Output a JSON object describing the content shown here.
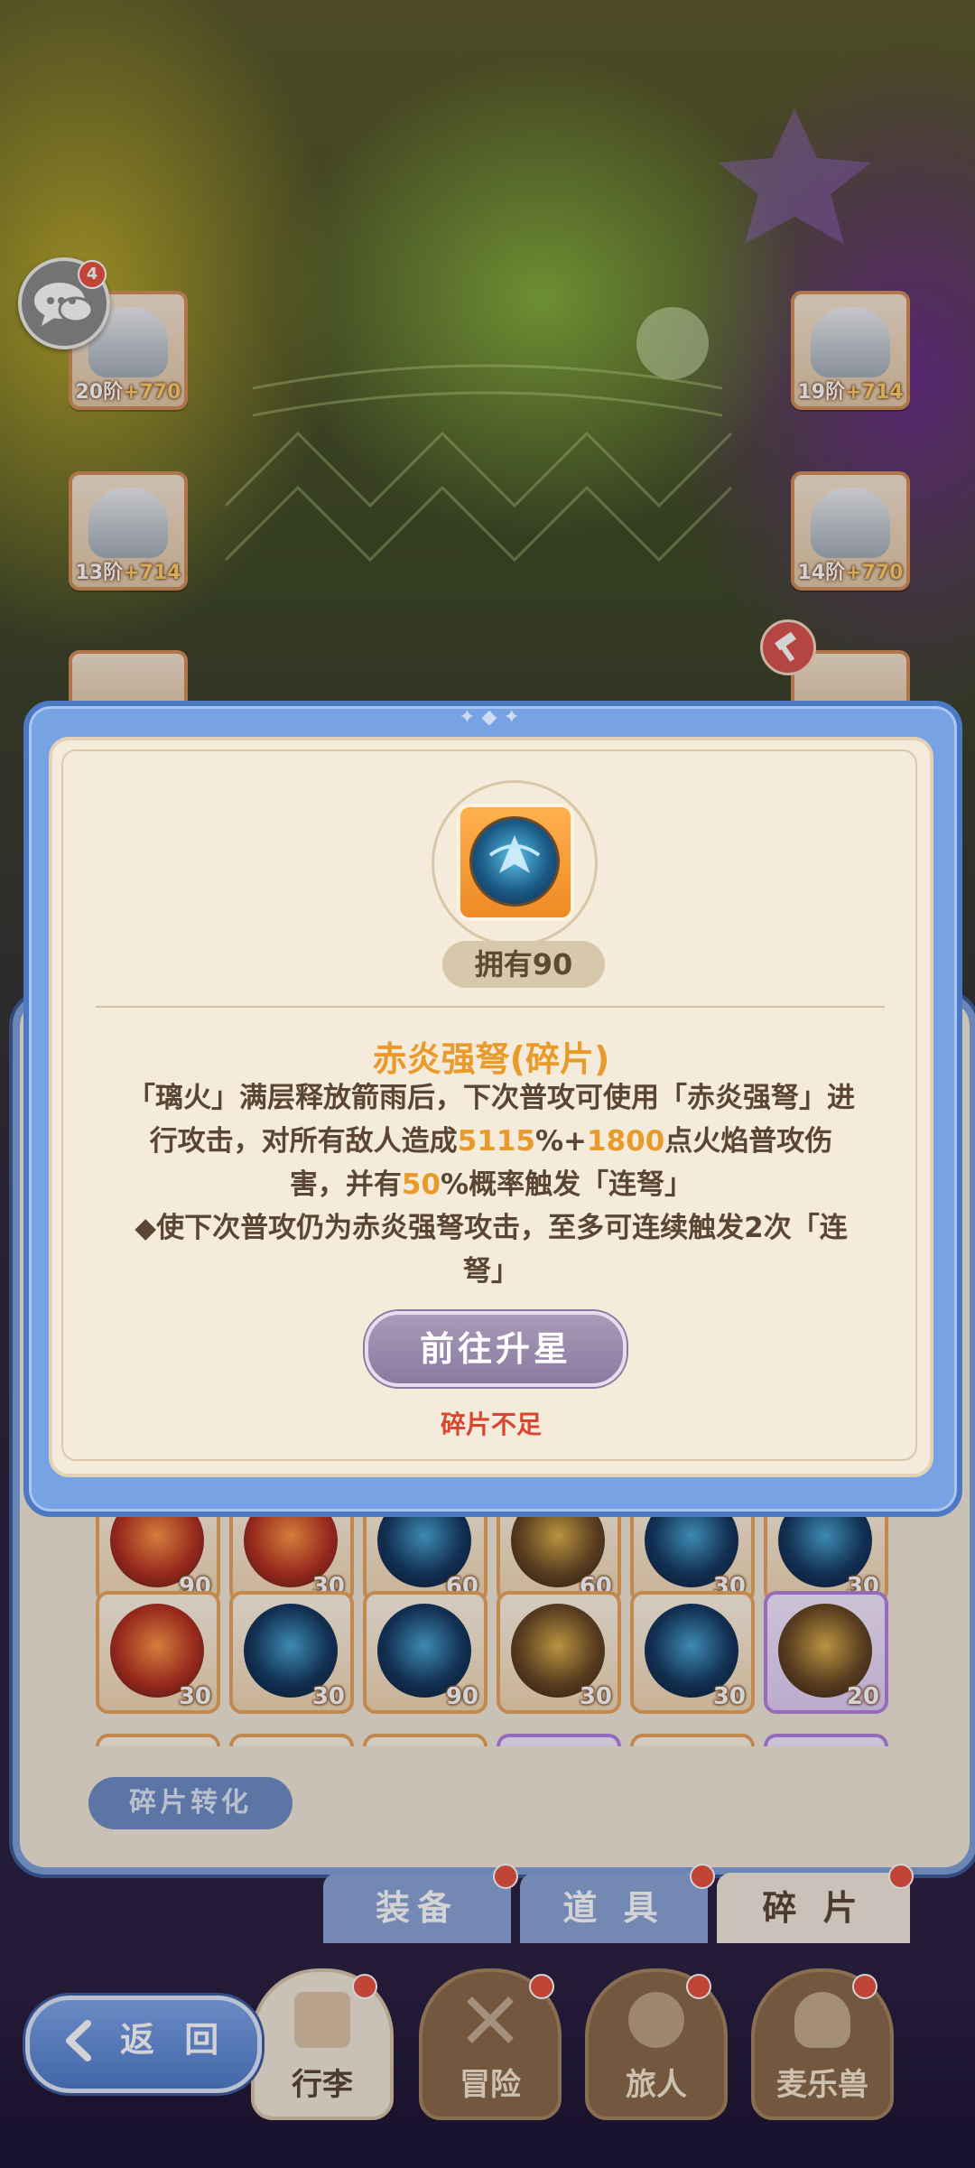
{
  "chat": {
    "badge": "4"
  },
  "equipment": [
    {
      "side": "left",
      "level": "20阶",
      "bonus": "+770"
    },
    {
      "side": "right",
      "level": "19阶",
      "bonus": "+714"
    },
    {
      "side": "left",
      "level": "13阶",
      "bonus": "+714"
    },
    {
      "side": "right",
      "level": "14阶",
      "bonus": "+770"
    }
  ],
  "dialog": {
    "owned": "拥有90",
    "title": "赤炎强弩(碎片)",
    "desc": {
      "p1": "「璃火」满层释放箭雨后，下次普攻可使用「赤炎强弩」进行攻击，对所有敌人造成",
      "v1": "5115",
      "p2": "%+",
      "v2": "1800",
      "p3": "点火焰普攻伤害，并有",
      "v3": "50",
      "p4": "%概率触发「连弩」",
      "bullet": "◆使下次普攻仍为赤炎强弩攻击，至多可连续触发2次「连弩」"
    },
    "goto_button": "前往升星",
    "warning": "碎片不足"
  },
  "fragments": {
    "row1_counts": [
      "90",
      "30",
      "60",
      "60",
      "30",
      "30"
    ],
    "row2": [
      {
        "count": "30",
        "style": "red"
      },
      {
        "count": "30",
        "style": "blue"
      },
      {
        "count": "90",
        "style": "blue"
      },
      {
        "count": "30",
        "style": "gold"
      },
      {
        "count": "30",
        "style": "blue"
      },
      {
        "count": "20",
        "style": "gold-purple"
      }
    ]
  },
  "convert_button": "碎片转化",
  "tabs": [
    "装备",
    "道 具",
    "碎 片"
  ],
  "active_tab": "碎 片",
  "nav": [
    "行李",
    "冒险",
    "旅人",
    "麦乐兽"
  ],
  "back_button": "返 回",
  "colors": {
    "accent": "#e89a2a",
    "warning": "#d9452f",
    "frame": "#77a3e4"
  }
}
